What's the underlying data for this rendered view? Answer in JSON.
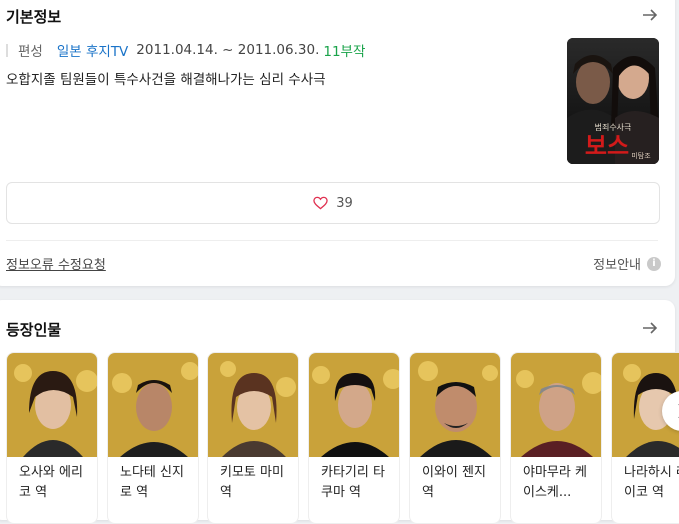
{
  "basic_info": {
    "title": "기본정보",
    "label": "편성",
    "network": "일본 후지TV",
    "dates": "2011.04.14. ~ 2011.06.30.",
    "episodes": "11부작",
    "synopsis": "오합지졸 팀원들이 특수사건을 해결해나가는 심리 수사극",
    "poster_caption": "범죄수사극",
    "poster_title": "보스",
    "poster_tag": "미탐조",
    "likes": "39",
    "report_link": "정보오류 수정요청",
    "info_guide": "정보안내",
    "info_icon": "i"
  },
  "cast": {
    "title": "등장인물",
    "items": [
      {
        "name": "오사와 에리코 역"
      },
      {
        "name": "노다테 신지로 역"
      },
      {
        "name": "키모토 마미 역"
      },
      {
        "name": "카타기리 타쿠마 역"
      },
      {
        "name": "이와이 젠지 역"
      },
      {
        "name": "야마무라 케이스케..."
      },
      {
        "name": "나라하시 레이코 역"
      }
    ]
  },
  "colors": {
    "network": "#1a73c8",
    "episodes": "#1aa34a",
    "heart": "#e03050",
    "photo_gold": "#c9a23a"
  },
  "icons": [
    "arrow-right-icon",
    "heart-icon",
    "info-icon",
    "chevron-right-icon"
  ]
}
